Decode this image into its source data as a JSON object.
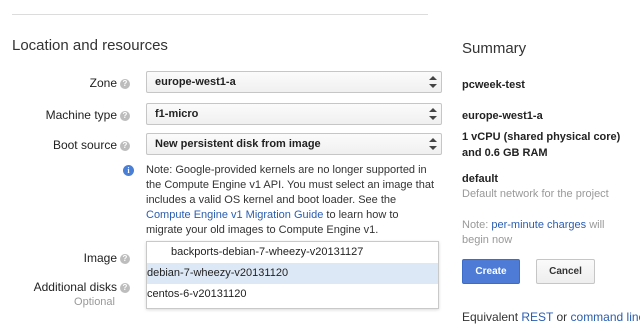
{
  "form": {
    "section_title": "Location and resources",
    "zone": {
      "label": "Zone",
      "value": "europe-west1-a"
    },
    "machine_type": {
      "label": "Machine type",
      "value": "f1-micro"
    },
    "boot_source": {
      "label": "Boot source",
      "value": "New persistent disk from image"
    },
    "note": {
      "text_1": "Note: Google-provided kernels are no longer supported in the Compute Engine v1 API. You must select an image that includes a valid OS kernel and boot loader. See the ",
      "link": "Compute Engine v1 Migration Guide",
      "text_2": " to learn how to migrate your old images to Compute Engine v1."
    },
    "image": {
      "label": "Image",
      "options": [
        "backports-debian-7-wheezy-v20131127",
        "debian-7-wheezy-v20131120",
        "centos-6-v20131120"
      ],
      "selected_index": 1
    },
    "additional_disks": {
      "label": "Additional disks",
      "sublabel": "Optional"
    }
  },
  "summary": {
    "title": "Summary",
    "instance_name": "pcweek-test",
    "zone": "europe-west1-a",
    "machine_desc_1": "1 vCPU (shared physical core)",
    "machine_desc_2": "and 0.6 GB RAM",
    "network": "default",
    "network_desc": "Default network for the project",
    "note_prefix": "Note: ",
    "note_link": "per-minute charges",
    "note_suffix_1": " will",
    "note_suffix_2": "begin now",
    "create_label": "Create",
    "cancel_label": "Cancel",
    "equiv_prefix": "Equivalent ",
    "equiv_rest": "REST",
    "equiv_or": " or ",
    "equiv_cmd": "command line"
  },
  "colors": {
    "accent": "#4d7bd6",
    "link": "#2a5db0",
    "selected_row": "#dde8f6"
  },
  "icons": {
    "help": "question-circle-icon",
    "info": "info-circle-icon",
    "select": "updown-arrows-icon"
  }
}
